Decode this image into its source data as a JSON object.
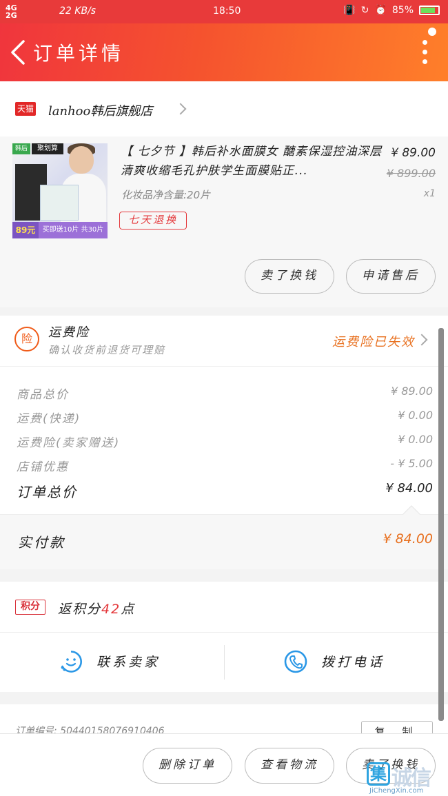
{
  "status_bar": {
    "signal_top": "4G",
    "signal_bottom": "2G",
    "net_speed": "22 KB/s",
    "time": "18:50",
    "battery_pct": "85%",
    "battery_level": 0.85
  },
  "header": {
    "title": "订单详情"
  },
  "shop": {
    "platform_badge": "天猫",
    "name": "lanhoo韩后旗舰店"
  },
  "product": {
    "thumb_badge_left": "韩后",
    "thumb_badge_right": "聚划算",
    "thumb_price": "89元",
    "thumb_promo": "买即送10片 共30片",
    "title": "【 七夕节 】韩后补水面膜女 醣素保湿控油深层清爽收缩毛孔护肤学生面膜贴正...",
    "spec": "化妆品净含量:20片",
    "price": "¥ 89.00",
    "original_price": "¥ 899.00",
    "quantity": "x1",
    "return_badge": "七天退换",
    "actions": [
      "卖了换钱",
      "申请售后"
    ]
  },
  "insurance": {
    "icon_char": "险",
    "title": "运费险",
    "subtitle": "确认收货前退货可理赔",
    "status": "运费险已失效"
  },
  "breakdown": {
    "rows": [
      {
        "label": "商品总价",
        "value": "¥ 89.00"
      },
      {
        "label": "运费(快递)",
        "value": "¥ 0.00"
      },
      {
        "label": "运费险(卖家赠送)",
        "value": "¥ 0.00"
      },
      {
        "label": "店铺优惠",
        "value": "- ¥ 5.00"
      }
    ],
    "total_label": "订单总价",
    "total_value": "¥ 84.00"
  },
  "paid": {
    "label": "实付款",
    "value": "¥ 84.00"
  },
  "points": {
    "badge": "积分",
    "prefix": "返积分",
    "count": "42",
    "suffix": "点"
  },
  "contact": {
    "seller": "联系卖家",
    "call": "拨打电话"
  },
  "order": {
    "number_label": "订单编号: 50440158076910406",
    "copy": "复 制"
  },
  "bottom_bar": {
    "buttons": [
      "删除订单",
      "查看物流",
      "卖了换钱"
    ]
  },
  "watermark": {
    "icon": "集",
    "text": "诚信",
    "url": "JiChengXin.com"
  }
}
